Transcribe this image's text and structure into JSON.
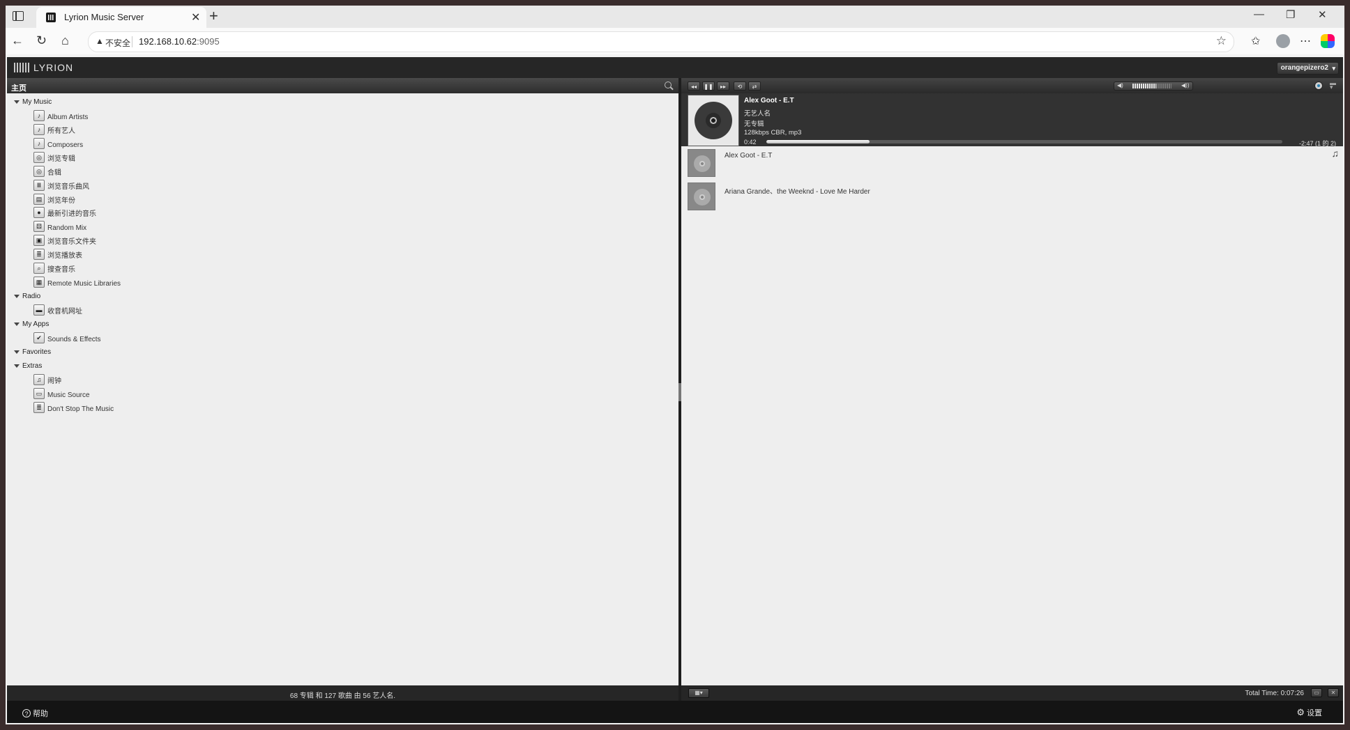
{
  "browser": {
    "tab_title": "Lyrion Music Server",
    "tab_close": "✕",
    "new_tab": "+",
    "window_controls": {
      "minimize": "—",
      "restore": "❐",
      "close": "✕"
    },
    "nav": {
      "back": "←",
      "reload": "↻",
      "home": "⌂"
    },
    "security_label": "不安全",
    "url_host": "192.168.10.62",
    "url_port": ":9095",
    "icons": [
      "warning-icon",
      "star-icon",
      "favorites-icon",
      "profile-icon",
      "more-icon",
      "copilot-icon"
    ]
  },
  "app": {
    "logo": "LYRION",
    "player": "orangepizero2"
  },
  "left_panel": {
    "title": "主页",
    "sections": [
      {
        "label": "My Music",
        "items": [
          {
            "label": "Album Artists",
            "icon": "♪"
          },
          {
            "label": "所有艺人",
            "icon": "♪"
          },
          {
            "label": "Composers",
            "icon": "♪"
          },
          {
            "label": "浏览专辑",
            "icon": "◎"
          },
          {
            "label": "合辑",
            "icon": "◎"
          },
          {
            "label": "浏览音乐曲风",
            "icon": "Ⅲ"
          },
          {
            "label": "浏览年份",
            "icon": "▤"
          },
          {
            "label": "最新引进的音乐",
            "icon": "●"
          },
          {
            "label": "Random Mix",
            "icon": "⚄"
          },
          {
            "label": "浏览音乐文件夹",
            "icon": "▣"
          },
          {
            "label": "浏览播放表",
            "icon": "≣"
          },
          {
            "label": "搜查音乐",
            "icon": "⌕"
          },
          {
            "label": "Remote Music Libraries",
            "icon": "▦"
          }
        ]
      },
      {
        "label": "Radio",
        "items": [
          {
            "label": "收音机网址",
            "icon": "▬"
          }
        ]
      },
      {
        "label": "My Apps",
        "items": [
          {
            "label": "Sounds & Effects",
            "icon": "✔"
          }
        ]
      },
      {
        "label": "Favorites",
        "items": []
      },
      {
        "label": "Extras",
        "items": [
          {
            "label": "闹钟",
            "icon": "♫"
          },
          {
            "label": "Music Source",
            "icon": "▭"
          },
          {
            "label": "Don't Stop The Music",
            "icon": "≣"
          }
        ]
      }
    ],
    "footer": "68 专辑 和 127 歌曲 由 56 艺人名."
  },
  "player": {
    "controls": {
      "prev": "◂◂",
      "pause": "❚❚",
      "next": "▸▸",
      "repeat": "⟲",
      "shuffle": "⇄"
    },
    "volume": 0.55,
    "now_playing": {
      "title": "Alex Goot - E.T",
      "artist": "无艺人名",
      "album": "无专辑",
      "format": "128kbps CBR, mp3",
      "elapsed": "0:42",
      "remaining": "-2:47  (1 的 2)",
      "progress": 0.2
    },
    "playlist": [
      {
        "title": "Alex Goot - E.T"
      },
      {
        "title": "Ariana Grande、the Weeknd - Love Me Harder"
      }
    ],
    "total_time": "Total Time: 0:07:26"
  },
  "bottom": {
    "help": "帮助",
    "settings": "设置"
  }
}
